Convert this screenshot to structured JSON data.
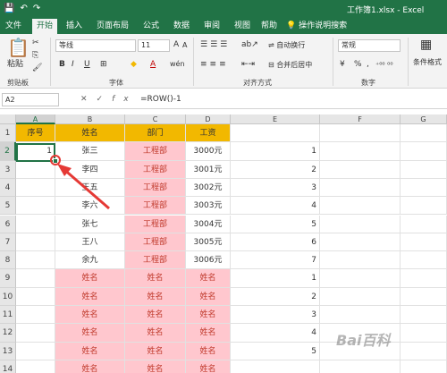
{
  "title_bar": {
    "qat": [
      "💾",
      "↶",
      "↷"
    ],
    "doc_title": "工作簿1.xlsx  -  Excel"
  },
  "tabs": [
    "文件",
    "开始",
    "插入",
    "页面布局",
    "公式",
    "数据",
    "审阅",
    "视图",
    "帮助"
  ],
  "active_tab": "开始",
  "tell_me": "操作说明搜索",
  "ribbon": {
    "clipboard": {
      "paste": "粘贴",
      "label": "剪贴板"
    },
    "font": {
      "name": "等线",
      "size": "11",
      "bold": "B",
      "italic": "I",
      "underline": "U",
      "grow": "A",
      "shrink": "A",
      "wen": "wén",
      "label": "字体"
    },
    "alignment": {
      "wrap": "自动换行",
      "merge": "合并后居中",
      "label": "对齐方式"
    },
    "number": {
      "format": "常规",
      "currency": "¥",
      "percent": "%",
      "comma": ",",
      "label": "数字"
    },
    "styles": {
      "conditional": "条件格式"
    }
  },
  "formula_bar": {
    "name_box": "A2",
    "formula": "=ROW()-1"
  },
  "columns": [
    "A",
    "B",
    "C",
    "D",
    "E",
    "F",
    "G"
  ],
  "rows": [
    "1",
    "2",
    "3",
    "4",
    "5",
    "6",
    "7",
    "8",
    "9",
    "10",
    "11",
    "12",
    "13",
    "14"
  ],
  "header_row": {
    "A": "序号",
    "B": "姓名",
    "C": "部门",
    "D": "工资"
  },
  "data_rows": [
    {
      "name": "张三",
      "dept": "工程部",
      "salary": "3000元",
      "e": "1"
    },
    {
      "name": "李四",
      "dept": "工程部",
      "salary": "3001元",
      "e": "2"
    },
    {
      "name": "王五",
      "dept": "工程部",
      "salary": "3002元",
      "e": "3"
    },
    {
      "name": "李六",
      "dept": "工程部",
      "salary": "3003元",
      "e": "4"
    },
    {
      "name": "张七",
      "dept": "工程部",
      "salary": "3004元",
      "e": "5"
    },
    {
      "name": "王八",
      "dept": "工程部",
      "salary": "3005元",
      "e": "6"
    },
    {
      "name": "余九",
      "dept": "工程部",
      "salary": "3006元",
      "e": "7"
    }
  ],
  "name_rows": [
    {
      "b": "姓名",
      "c": "姓名",
      "d": "姓名",
      "e": "1"
    },
    {
      "b": "姓名",
      "c": "姓名",
      "d": "姓名",
      "e": "2"
    },
    {
      "b": "姓名",
      "c": "姓名",
      "d": "姓名",
      "e": "3"
    },
    {
      "b": "姓名",
      "c": "姓名",
      "d": "姓名",
      "e": "4"
    },
    {
      "b": "姓名",
      "c": "姓名",
      "d": "姓名",
      "e": "5"
    },
    {
      "b": "姓名",
      "c": "姓名",
      "d": "姓名",
      "e": ""
    }
  ],
  "selected_cell_value": "1",
  "watermark": "Bai百科"
}
